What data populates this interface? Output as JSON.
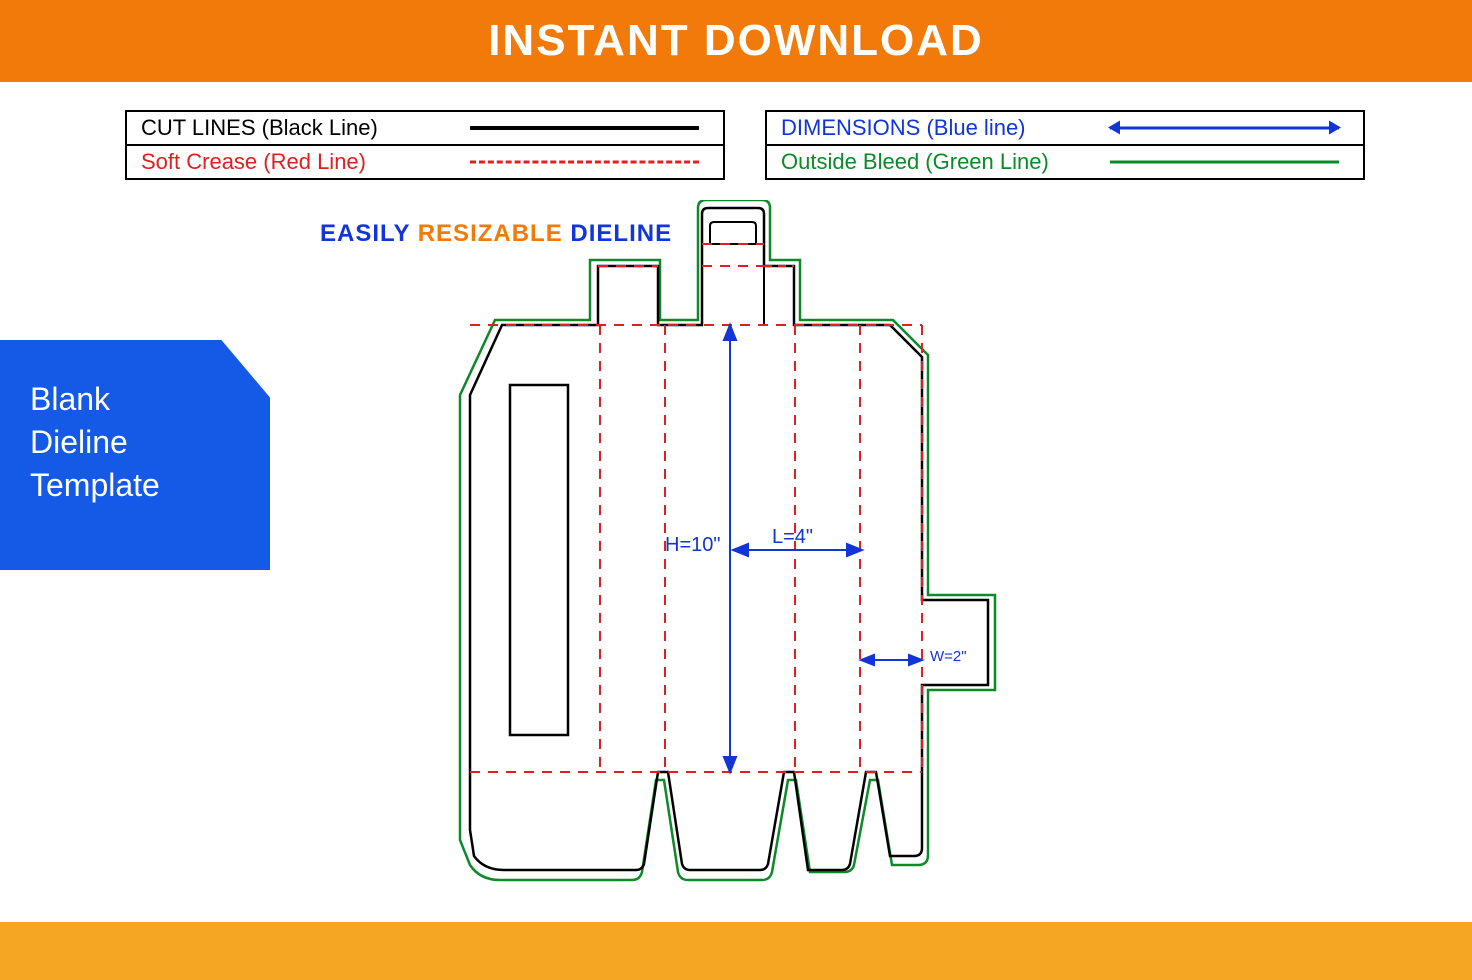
{
  "banner": {
    "top": "INSTANT DOWNLOAD"
  },
  "legend": {
    "left": {
      "row1": "CUT LINES (Black Line)",
      "row2": "Soft Crease (Red Line)"
    },
    "right": {
      "row1": "DIMENSIONS (Blue line)",
      "row2": "Outside Bleed (Green Line)"
    }
  },
  "tagline": {
    "w1": "EASILY",
    "w2": "RESIZABLE",
    "w3": "DIELINE"
  },
  "badge": {
    "l1": "Blank",
    "l2": "Dieline",
    "l3": "Template"
  },
  "dimensions": {
    "height": "H=10\"",
    "length": "L=4\"",
    "width": "W=2\""
  },
  "colors": {
    "cut": "#000000",
    "crease": "#e02020",
    "dim": "#1135d6",
    "bleed": "#0c8a2a",
    "accent_orange": "#f17a0a"
  },
  "chart_data": {
    "type": "table",
    "title": "Dieline panel dimensions",
    "categories": [
      "H",
      "L",
      "W"
    ],
    "values": [
      10,
      4,
      2
    ],
    "units": "inches",
    "legend": [
      {
        "label": "Cut Lines",
        "color": "#000000",
        "style": "solid"
      },
      {
        "label": "Soft Crease",
        "color": "#e02020",
        "style": "dashed"
      },
      {
        "label": "Dimensions",
        "color": "#1135d6",
        "style": "arrow"
      },
      {
        "label": "Outside Bleed",
        "color": "#0c8a2a",
        "style": "solid"
      }
    ]
  }
}
